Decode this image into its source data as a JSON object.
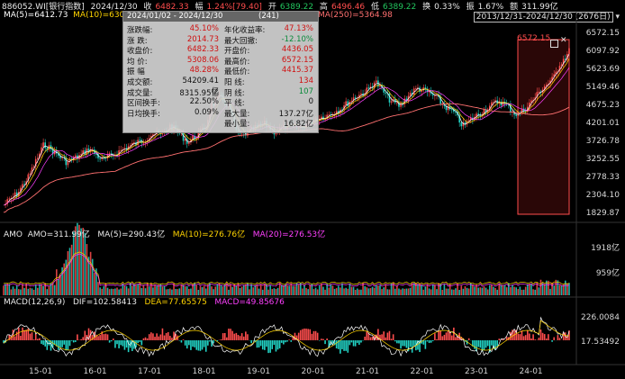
{
  "topbar": {
    "code": "886052.WI[银行指数]",
    "date": "2024/12/30",
    "close_label": "收",
    "close": "6482.33",
    "change_label": "幅",
    "change": "1.24%[79.40]",
    "open_label": "开",
    "open": "6389.22",
    "high_label": "高",
    "high": "6496.46",
    "low_label": "低",
    "low": "6389.22",
    "turnover_label": "换",
    "turnover": "0.33%",
    "amplitude_label": "振",
    "amplitude": "1.67%",
    "amount_label": "额",
    "amount": "311.99亿"
  },
  "ma_legend": {
    "ma5": "MA(5)=6412.73",
    "ma10": "MA(10)=6305.83",
    "ma250": "MA(250)=5364.98"
  },
  "range_label": "2013/12/31-2024/12/30 (2676日)",
  "y_axis": [
    "6572.15",
    "6097.92",
    "5623.69",
    "5149.46",
    "4675.23",
    "4201.01",
    "3726.78",
    "3252.55",
    "2778.33",
    "2304.10",
    "1829.87"
  ],
  "highlight_high": "6572.15",
  "popup": {
    "range": "2024/01/02 - 2024/12/30",
    "count": "(241)",
    "left": [
      {
        "label": "涨跌幅:",
        "value": "45.10%",
        "color": "red"
      },
      {
        "label": "涨  跌:",
        "value": "2014.73",
        "color": "red"
      },
      {
        "label": "收盘价:",
        "value": "6482.33",
        "color": "red"
      },
      {
        "label": "均  价:",
        "value": "5308.06",
        "color": "red"
      },
      {
        "label": "振  幅",
        "value": "48.28%",
        "color": "red"
      },
      {
        "label": "成交额:",
        "value": "54209.41亿",
        "color": "dark"
      },
      {
        "label": "成交量:",
        "value": "8315.95亿",
        "color": "dark"
      },
      {
        "label": "区间换手:",
        "value": "22.50%",
        "color": "dark"
      },
      {
        "label": "日均换手:",
        "value": "0.09%",
        "color": "dark"
      }
    ],
    "right": [
      {
        "label": "年化收益率:",
        "value": "47.13%",
        "color": "red"
      },
      {
        "label": "最大回撤:",
        "value": "-12.10%",
        "color": "green"
      },
      {
        "label": "开盘价:",
        "value": "4436.05",
        "color": "red"
      },
      {
        "label": "最高价:",
        "value": "6572.15",
        "color": "red"
      },
      {
        "label": "最低价:",
        "value": "4415.37",
        "color": "red"
      },
      {
        "label": "阳  线:",
        "value": "134",
        "color": "red"
      },
      {
        "label": "阴  线:",
        "value": "107",
        "color": "green"
      },
      {
        "label": "平  线:",
        "value": "0",
        "color": "dark"
      },
      {
        "label": "最大量:",
        "value": "137.27亿",
        "color": "dark"
      },
      {
        "label": "最小量:",
        "value": "16.82亿",
        "color": "dark"
      }
    ]
  },
  "amo": {
    "title": "AMO",
    "amo": "AMO=311.99亿",
    "ma5": "MA(5)=290.43亿",
    "ma10": "MA(10)=276.76亿",
    "ma20": "MA(20)=276.53亿",
    "axis": [
      "1918亿",
      "959亿"
    ]
  },
  "macd": {
    "title": "MACD(12,26,9)",
    "dif": "DIF=102.58413",
    "dea": "DEA=77.65575",
    "macd": "MACD=49.85676",
    "axis": [
      "226.0084",
      "17.53492"
    ]
  },
  "x_axis": [
    "15-01",
    "16-01",
    "17-01",
    "18-01",
    "19-01",
    "20-01",
    "21-01",
    "22-01",
    "23-01",
    "24-01"
  ],
  "colors": {
    "up": "#ff4d4d",
    "down": "#22d3c5",
    "ma5": "#ffffff",
    "ma10": "#ffd400",
    "ma20": "#ff40ff",
    "ma250": "#ff7070"
  }
}
